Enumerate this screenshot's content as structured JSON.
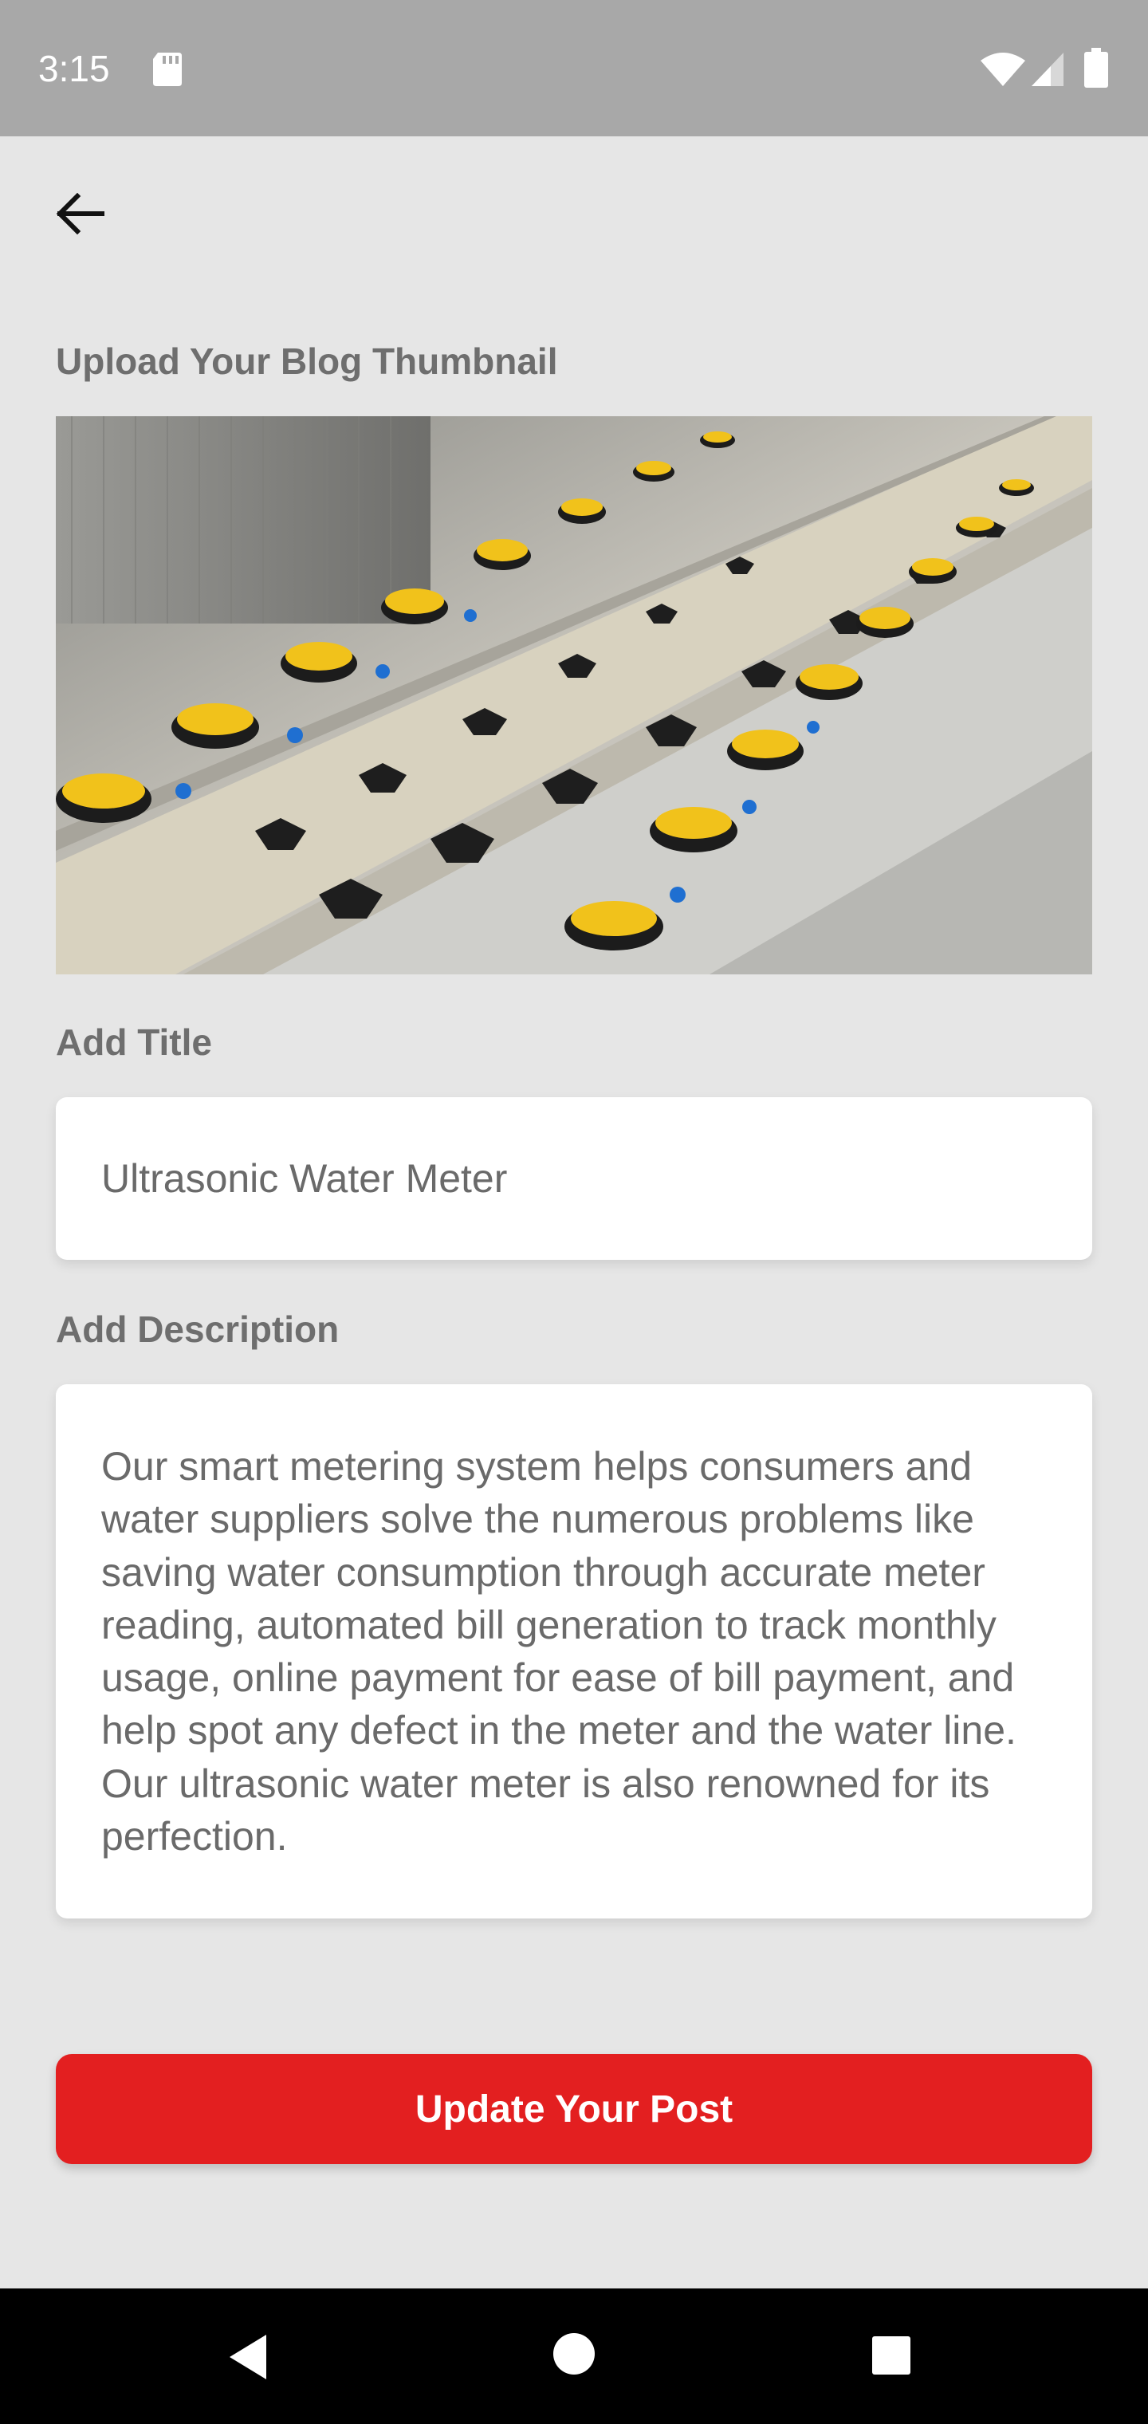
{
  "status_bar": {
    "time": "3:15",
    "icons": [
      "sd-card-icon",
      "wifi-icon",
      "signal-icon",
      "battery-icon"
    ]
  },
  "header": {
    "back_icon": "arrow-left-icon"
  },
  "thumbnail": {
    "label": "Upload Your Blog Thumbnail",
    "image_subject": "conveyor line of yellow water meters"
  },
  "title": {
    "label": "Add Title",
    "value": "Ultrasonic Water Meter"
  },
  "description": {
    "label": "Add Description",
    "value": "Our smart metering system helps consumers and water suppliers solve the numerous problems like saving water consumption through accurate meter reading, automated bill generation to track monthly usage, online payment for ease of bill payment, and help spot any defect in the meter and the water line. Our ultrasonic water meter is also renowned for its perfection."
  },
  "actions": {
    "update_label": "Update Your Post"
  },
  "nav_bar": {
    "icons": [
      "back-triangle-icon",
      "home-circle-icon",
      "recents-square-icon"
    ]
  },
  "colors": {
    "background": "#e6e6e6",
    "status_bar": "#a8a8a8",
    "accent": "#e31f20",
    "label_text": "#6e6e6e",
    "input_text": "#6a6a6a"
  }
}
